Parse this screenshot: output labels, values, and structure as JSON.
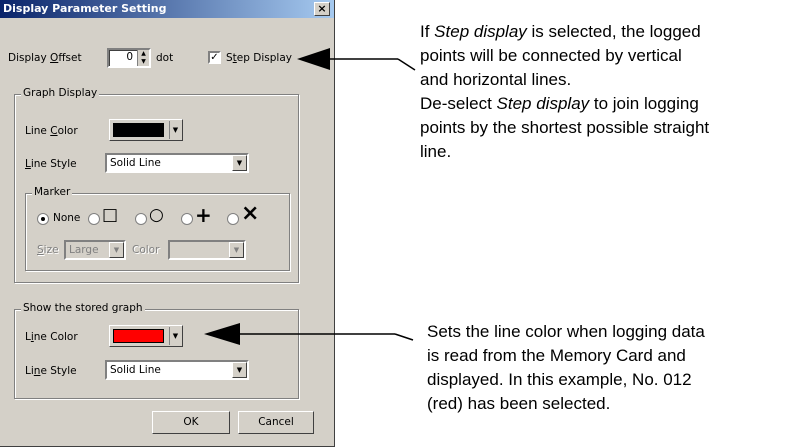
{
  "dialog": {
    "title": "Display Parameter Setting",
    "close_label": "×",
    "display_offset": {
      "label_pre": "Display ",
      "label_ul": "O",
      "label_post": "ffset",
      "value": "0",
      "unit": "dot"
    },
    "step_display": {
      "checked_glyph": "✓",
      "label_pre": "S",
      "label_ul": "t",
      "label_post": "ep Display"
    },
    "graph_display": {
      "title": "Graph Display",
      "line_color_label_pre": "Line ",
      "line_color_label_ul": "C",
      "line_color_label_post": "olor",
      "line_color_value": "#000000",
      "line_style_label_pre": "",
      "line_style_label_ul": "L",
      "line_style_label_post": "ine Style",
      "line_style_value": "Solid Line",
      "marker": {
        "title": "Marker",
        "options": [
          "None",
          "□",
          "○",
          "+",
          "×"
        ],
        "selected": "None",
        "size_label_pre": "",
        "size_label_ul": "S",
        "size_label_post": "ize",
        "size_value": "Large",
        "color_label": "Color"
      }
    },
    "stored_graph": {
      "title": "Show the stored graph",
      "line_color_label_pre": "L",
      "line_color_label_ul": "i",
      "line_color_label_post": "ne Color",
      "line_color_value": "#ff0000",
      "line_style_label_pre": "Li",
      "line_style_label_ul": "n",
      "line_style_label_post": "e Style",
      "line_style_value": "Solid Line"
    },
    "ok_label": "OK",
    "cancel_label": "Cancel"
  },
  "annotations": {
    "step": {
      "line1_pre": "If ",
      "line1_em": "Step display",
      "line1_post": " is selected, the logged",
      "line2": "points will be connected by vertical",
      "line3": "and horizontal lines.",
      "line4_pre": "De-select ",
      "line4_em": "Step display",
      "line4_post": " to join logging",
      "line5": "points by the shortest possible straight",
      "line6": "line."
    },
    "stored": {
      "line1": "Sets the line color when logging data",
      "line2": "is read from the Memory Card and",
      "line3": "displayed. In this example, No. 012",
      "line4": "(red) has been selected."
    }
  },
  "icons": {
    "dropdown_arrow": "▼",
    "spin_up": "▲",
    "spin_down": "▼"
  }
}
